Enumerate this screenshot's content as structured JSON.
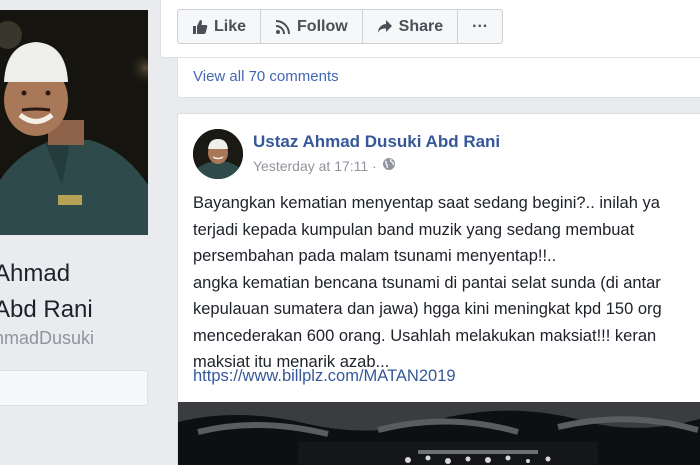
{
  "profile": {
    "name_line1": "Ahmad",
    "name_line2": "Abd Rani",
    "handle": "hmadDusuki"
  },
  "actions": [
    {
      "label": "Like",
      "icon": "thumbs-up-icon"
    },
    {
      "label": "Follow",
      "icon": "rss-icon"
    },
    {
      "label": "Share",
      "icon": "share-arrow-icon"
    },
    {
      "label": "···",
      "icon": "more-icon"
    }
  ],
  "comments": {
    "view_all": "View all 70 comments"
  },
  "post": {
    "author": "Ustaz Ahmad Dusuki Abd Rani",
    "timestamp": "Yesterday at 17:11 ·",
    "privacy_icon": "globe-icon",
    "text_lines": [
      "Bayangkan kematian menyentap saat sedang begini?.. inilah ya",
      "terjadi kepada kumpulan band muzik yang sedang membuat",
      "persembahan pada malam tsunami menyentap!!..",
      "angka kematian bencana tsunami di pantai selat sunda (di antar",
      "kepulauan sumatera dan jawa) hgga kini meningkat kpd 150 org",
      "mencederakan 600 orang. Usahlah melakukan maksiat!!! keran",
      "maksiat itu menarik azab..."
    ],
    "link": "https://www.billplz.com/MATAN2019"
  },
  "colors": {
    "link": "#365899",
    "accent": "#4267b2",
    "muted": "#90949c",
    "background": "#e9ebee"
  }
}
